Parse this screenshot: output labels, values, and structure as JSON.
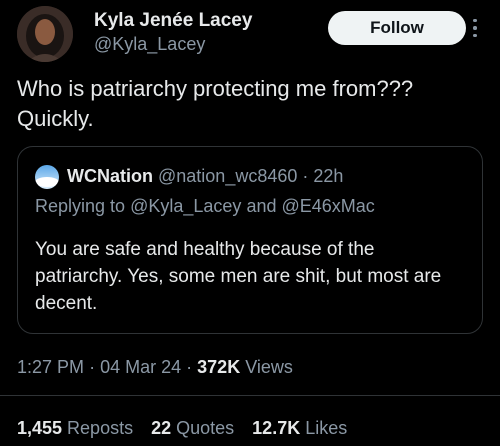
{
  "author": {
    "name": "Kyla Jenée Lacey",
    "handle": "@Kyla_Lacey",
    "avatar_icon": "profile-photo"
  },
  "follow_label": "Follow",
  "more_icon": "more-options-icon",
  "tweet": {
    "text": "Who is patriarchy protecting me from??? Quickly."
  },
  "quote": {
    "name": "WCNation",
    "handle": "@nation_wc8460",
    "separator": "·",
    "time_ago": "22h",
    "replying_prefix": "Replying to",
    "replying_user1": "@Kyla_Lacey",
    "replying_and": "and",
    "replying_user2": "@E46xMac",
    "text": "You are safe and healthy because of the patriarchy. Yes, some men are shit, but most are decent.",
    "avatar_icon": "sky-avatar"
  },
  "meta": {
    "time": "1:27 PM",
    "sep1": "·",
    "date": "04 Mar 24",
    "sep2": "·",
    "views_count": "372K",
    "views_label": "Views"
  },
  "stats": {
    "reposts_count": "1,455",
    "reposts_label": "Reposts",
    "quotes_count": "22",
    "quotes_label": "Quotes",
    "likes_count": "12.7K",
    "likes_label": "Likes"
  },
  "colors": {
    "background": "#000000",
    "text_primary": "#e7e9ea",
    "text_secondary": "#8b98a5",
    "border": "#2f3336",
    "follow_bg": "#eff3f4"
  }
}
